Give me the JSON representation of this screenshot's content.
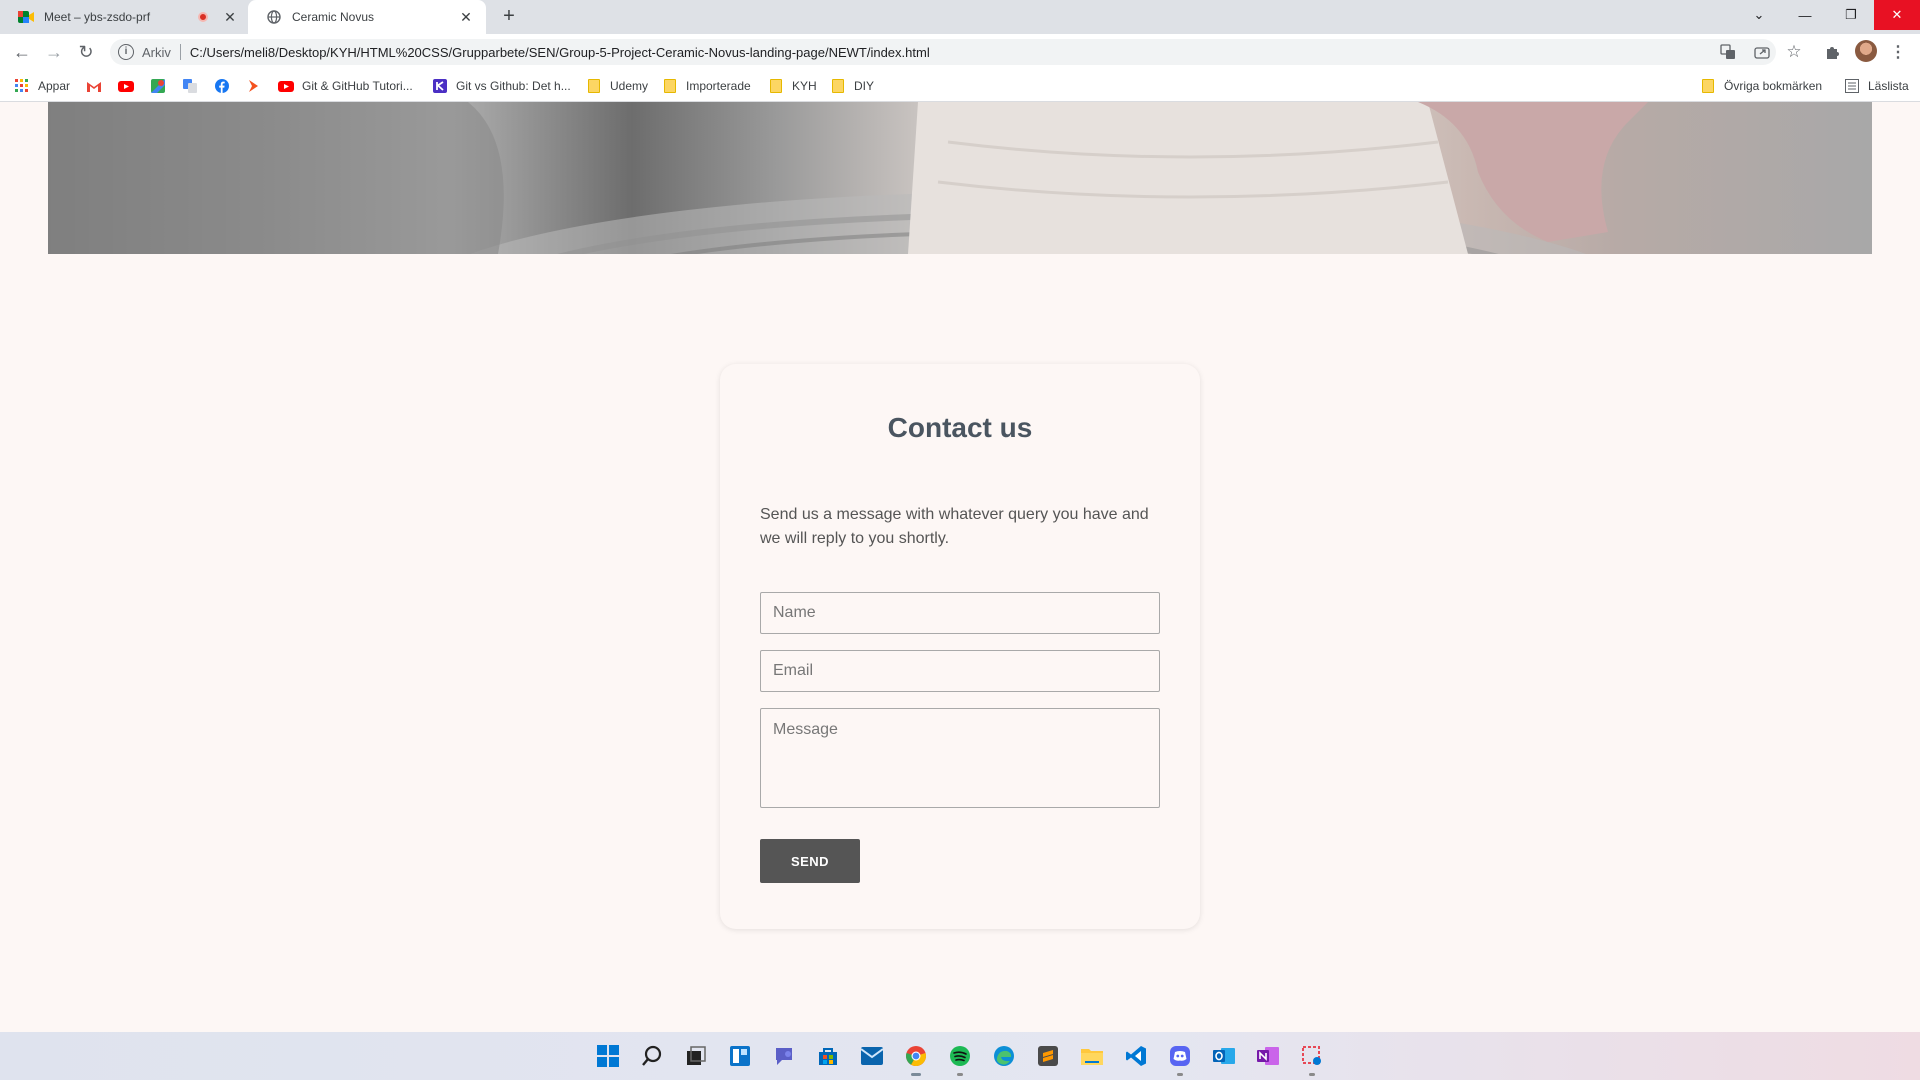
{
  "browser": {
    "tabs": [
      {
        "title": "Meet – ybs-zsdo-prf",
        "icon": "google-meet-icon",
        "recording": true
      },
      {
        "title": "Ceramic Novus",
        "icon": "globe-icon",
        "active": true
      }
    ],
    "scheme_label": "Arkiv",
    "url": "C:/Users/meli8/Desktop/KYH/HTML%20CSS/Grupparbete/SEN/Group-5-Project-Ceramic-Novus-landing-page/NEWT/index.html",
    "bookmarks": [
      {
        "label": "Appar",
        "icon": "apps-grid-icon"
      },
      {
        "label": "",
        "icon": "gmail-icon"
      },
      {
        "label": "",
        "icon": "youtube-icon"
      },
      {
        "label": "",
        "icon": "google-maps-icon"
      },
      {
        "label": "",
        "icon": "google-translate-icon"
      },
      {
        "label": "",
        "icon": "facebook-icon"
      },
      {
        "label": "",
        "icon": "chevron-bookmark-icon"
      },
      {
        "label": "Git & GitHub Tutori...",
        "icon": "youtube-icon"
      },
      {
        "label": "Git vs Github: Det h...",
        "icon": "k-icon"
      },
      {
        "label": "Udemy",
        "icon": "folder-icon"
      },
      {
        "label": "Importerade",
        "icon": "folder-icon"
      },
      {
        "label": "KYH",
        "icon": "folder-icon"
      },
      {
        "label": "DIY",
        "icon": "folder-icon"
      }
    ],
    "other_bookmarks": "Övriga bokmärken",
    "reading_list": "Läslista"
  },
  "page": {
    "contact": {
      "title": "Contact us",
      "intro": "Send us a message with whatever query you have and we will reply to you shortly.",
      "name_placeholder": "Name",
      "email_placeholder": "Email",
      "message_placeholder": "Message",
      "send_label": "SEND"
    }
  },
  "taskbar": {
    "apps": [
      "windows-start-icon",
      "search-icon",
      "task-view-icon",
      "widgets-icon",
      "teams-chat-icon",
      "microsoft-store-icon",
      "mail-icon",
      "chrome-icon",
      "spotify-icon",
      "edge-icon",
      "sublime-text-icon",
      "file-explorer-icon",
      "vscode-icon",
      "discord-icon",
      "outlook-icon",
      "onenote-icon",
      "snipping-tool-icon"
    ]
  },
  "colors": {
    "accent_close": "#e81123",
    "send_button": "#555555",
    "heading": "#4a5560",
    "page_bg": "#fdf7f5"
  }
}
